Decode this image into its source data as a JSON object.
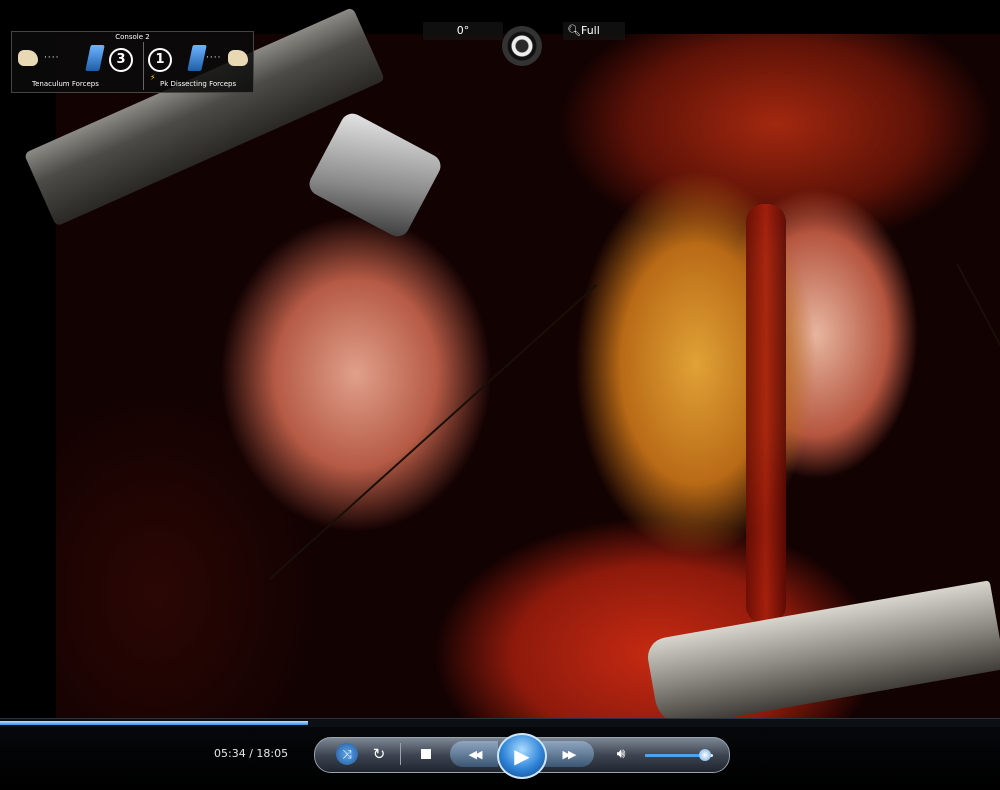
{
  "video": {
    "hud": {
      "angle": "0°",
      "view_mode": "Full"
    },
    "console": {
      "title": "Console 2",
      "left_arm": {
        "arm_number": "3",
        "tool_label": "Tenaculum Forceps",
        "dots": "····"
      },
      "right_arm": {
        "arm_number": "1",
        "tool_label": "Pk Dissecting Forceps",
        "dots": "····"
      }
    }
  },
  "player": {
    "time": "05:34 / 18:05",
    "progress_fraction": 0.308,
    "volume_fraction": 0.88,
    "icons": {
      "shuffle": "shuffle-icon",
      "repeat": "repeat-icon",
      "stop": "stop-icon",
      "previous": "previous-icon",
      "play": "play-icon",
      "next": "next-icon",
      "volume": "volume-icon"
    },
    "colors": {
      "accent": "#2f84d8",
      "seek_fill": "#3c8fe0"
    }
  }
}
